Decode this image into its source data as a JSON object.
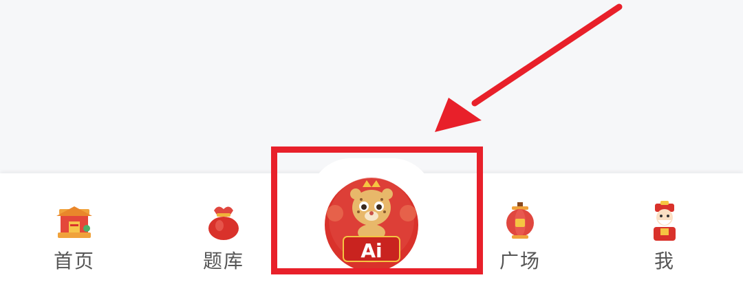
{
  "tabbar": {
    "items": [
      {
        "label": "首页",
        "icon": "temple-house-icon"
      },
      {
        "label": "题库",
        "icon": "red-lucky-bag-icon"
      },
      {
        "label": "Ai",
        "icon": "leopard-mascot-ai-icon"
      },
      {
        "label": "广场",
        "icon": "red-lantern-icon"
      },
      {
        "label": "我",
        "icon": "fortune-god-icon"
      }
    ]
  },
  "annotation": {
    "arrow_color": "#e8202a",
    "box_color": "#e8202a"
  },
  "colors": {
    "accent_red": "#d9322b",
    "background": "#f6f7f9"
  }
}
